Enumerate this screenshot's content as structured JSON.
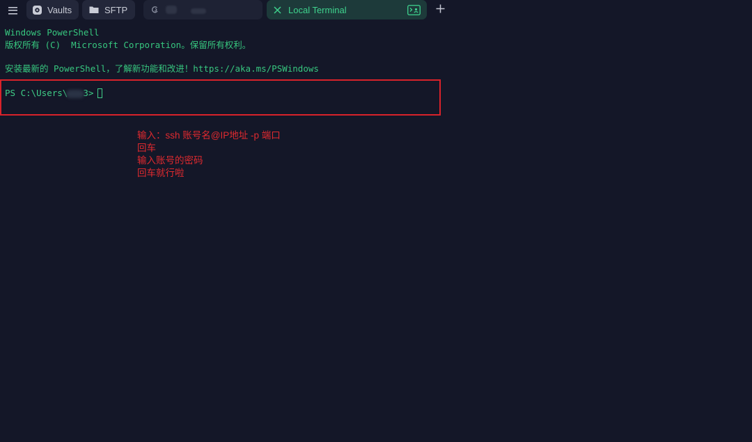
{
  "tabs": {
    "menu_icon": "hamburger-menu-icon",
    "vaults_label": "Vaults",
    "sftp_label": "SFTP",
    "local_terminal_label": "Local Terminal",
    "active_color": "#3fd38e"
  },
  "terminal": {
    "line1": "Windows PowerShell",
    "line2": "版权所有 (C)  Microsoft Corporation。保留所有权利。",
    "line3": "安装最新的 PowerShell，了解新功能和改进！https://aka.ms/PSWindows",
    "prompt_prefix": "PS C:\\Users\\",
    "prompt_suffix": "3>",
    "text_color": "#37c77f"
  },
  "annotations": {
    "step1": "输入：ssh 账号名@IP地址 -p 端口",
    "step2": "回车",
    "step3": "输入账号的密码",
    "step4": "回车就行啦",
    "color": "#e02a2f"
  }
}
